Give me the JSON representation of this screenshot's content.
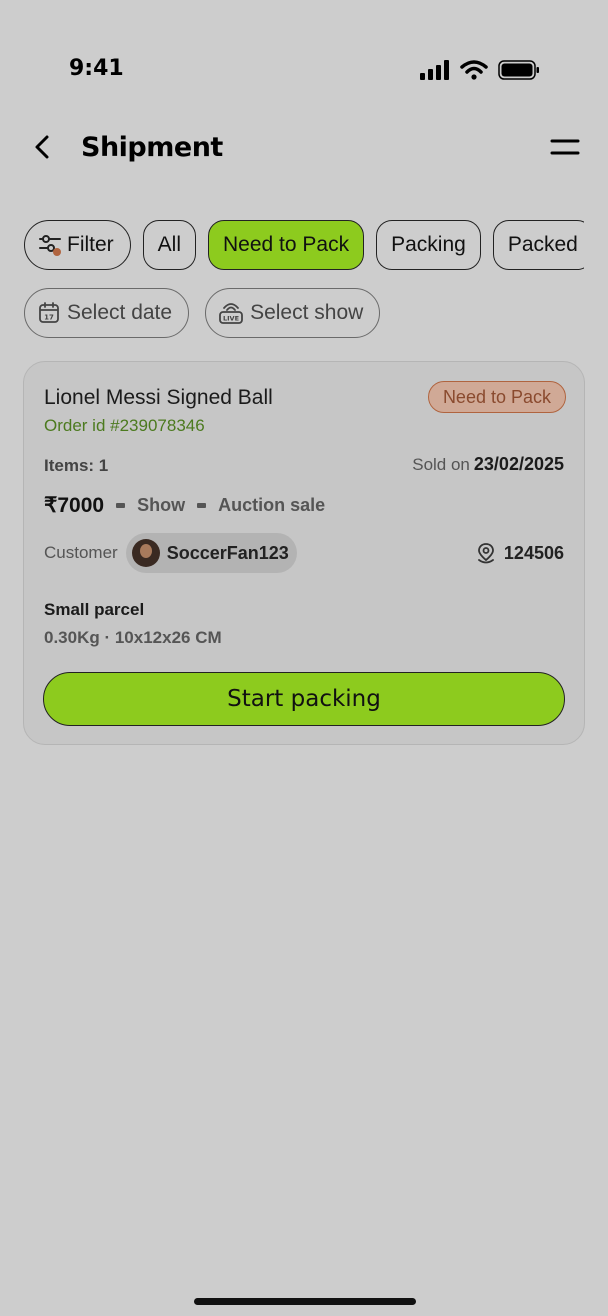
{
  "status_bar": {
    "time": "9:41"
  },
  "header": {
    "title": "Shipment"
  },
  "filters": {
    "filter_label": "Filter",
    "tabs": [
      {
        "label": "All",
        "active": false
      },
      {
        "label": "Need to Pack",
        "active": true
      },
      {
        "label": "Packing",
        "active": false
      },
      {
        "label": "Packed",
        "active": false
      }
    ],
    "select_date": "Select date",
    "select_show": "Select show"
  },
  "order": {
    "product_name": "Lionel Messi Signed Ball",
    "order_id": "Order id #239078346",
    "status": "Need to Pack",
    "items": "Items: 1",
    "sold_on_label": "Sold on",
    "sold_on_date": "23/02/2025",
    "price": "₹7000",
    "sale_channel": "Show",
    "sale_type": "Auction sale",
    "customer_label": "Customer",
    "customer_name": "SoccerFan123",
    "pincode": "124506",
    "parcel_type": "Small parcel",
    "parcel_dims": "0.30Kg · 10x12x26 CM",
    "cta": "Start packing"
  },
  "colors": {
    "accent": "#8dcb1e",
    "order_id": "#4c7a1f",
    "badge_bg": "#d0a996",
    "badge_border": "#b0643f",
    "background": "#cdcdcd"
  }
}
